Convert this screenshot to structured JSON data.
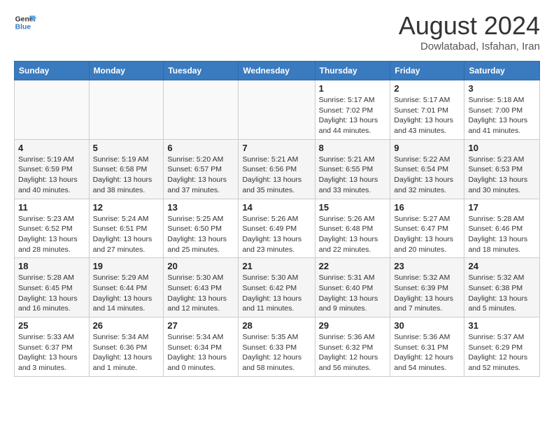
{
  "header": {
    "logo_line1": "General",
    "logo_line2": "Blue",
    "month_year": "August 2024",
    "location": "Dowlatabad, Isfahan, Iran"
  },
  "weekdays": [
    "Sunday",
    "Monday",
    "Tuesday",
    "Wednesday",
    "Thursday",
    "Friday",
    "Saturday"
  ],
  "weeks": [
    [
      {
        "day": "",
        "info": ""
      },
      {
        "day": "",
        "info": ""
      },
      {
        "day": "",
        "info": ""
      },
      {
        "day": "",
        "info": ""
      },
      {
        "day": "1",
        "info": "Sunrise: 5:17 AM\nSunset: 7:02 PM\nDaylight: 13 hours\nand 44 minutes."
      },
      {
        "day": "2",
        "info": "Sunrise: 5:17 AM\nSunset: 7:01 PM\nDaylight: 13 hours\nand 43 minutes."
      },
      {
        "day": "3",
        "info": "Sunrise: 5:18 AM\nSunset: 7:00 PM\nDaylight: 13 hours\nand 41 minutes."
      }
    ],
    [
      {
        "day": "4",
        "info": "Sunrise: 5:19 AM\nSunset: 6:59 PM\nDaylight: 13 hours\nand 40 minutes."
      },
      {
        "day": "5",
        "info": "Sunrise: 5:19 AM\nSunset: 6:58 PM\nDaylight: 13 hours\nand 38 minutes."
      },
      {
        "day": "6",
        "info": "Sunrise: 5:20 AM\nSunset: 6:57 PM\nDaylight: 13 hours\nand 37 minutes."
      },
      {
        "day": "7",
        "info": "Sunrise: 5:21 AM\nSunset: 6:56 PM\nDaylight: 13 hours\nand 35 minutes."
      },
      {
        "day": "8",
        "info": "Sunrise: 5:21 AM\nSunset: 6:55 PM\nDaylight: 13 hours\nand 33 minutes."
      },
      {
        "day": "9",
        "info": "Sunrise: 5:22 AM\nSunset: 6:54 PM\nDaylight: 13 hours\nand 32 minutes."
      },
      {
        "day": "10",
        "info": "Sunrise: 5:23 AM\nSunset: 6:53 PM\nDaylight: 13 hours\nand 30 minutes."
      }
    ],
    [
      {
        "day": "11",
        "info": "Sunrise: 5:23 AM\nSunset: 6:52 PM\nDaylight: 13 hours\nand 28 minutes."
      },
      {
        "day": "12",
        "info": "Sunrise: 5:24 AM\nSunset: 6:51 PM\nDaylight: 13 hours\nand 27 minutes."
      },
      {
        "day": "13",
        "info": "Sunrise: 5:25 AM\nSunset: 6:50 PM\nDaylight: 13 hours\nand 25 minutes."
      },
      {
        "day": "14",
        "info": "Sunrise: 5:26 AM\nSunset: 6:49 PM\nDaylight: 13 hours\nand 23 minutes."
      },
      {
        "day": "15",
        "info": "Sunrise: 5:26 AM\nSunset: 6:48 PM\nDaylight: 13 hours\nand 22 minutes."
      },
      {
        "day": "16",
        "info": "Sunrise: 5:27 AM\nSunset: 6:47 PM\nDaylight: 13 hours\nand 20 minutes."
      },
      {
        "day": "17",
        "info": "Sunrise: 5:28 AM\nSunset: 6:46 PM\nDaylight: 13 hours\nand 18 minutes."
      }
    ],
    [
      {
        "day": "18",
        "info": "Sunrise: 5:28 AM\nSunset: 6:45 PM\nDaylight: 13 hours\nand 16 minutes."
      },
      {
        "day": "19",
        "info": "Sunrise: 5:29 AM\nSunset: 6:44 PM\nDaylight: 13 hours\nand 14 minutes."
      },
      {
        "day": "20",
        "info": "Sunrise: 5:30 AM\nSunset: 6:43 PM\nDaylight: 13 hours\nand 12 minutes."
      },
      {
        "day": "21",
        "info": "Sunrise: 5:30 AM\nSunset: 6:42 PM\nDaylight: 13 hours\nand 11 minutes."
      },
      {
        "day": "22",
        "info": "Sunrise: 5:31 AM\nSunset: 6:40 PM\nDaylight: 13 hours\nand 9 minutes."
      },
      {
        "day": "23",
        "info": "Sunrise: 5:32 AM\nSunset: 6:39 PM\nDaylight: 13 hours\nand 7 minutes."
      },
      {
        "day": "24",
        "info": "Sunrise: 5:32 AM\nSunset: 6:38 PM\nDaylight: 13 hours\nand 5 minutes."
      }
    ],
    [
      {
        "day": "25",
        "info": "Sunrise: 5:33 AM\nSunset: 6:37 PM\nDaylight: 13 hours\nand 3 minutes."
      },
      {
        "day": "26",
        "info": "Sunrise: 5:34 AM\nSunset: 6:36 PM\nDaylight: 13 hours\nand 1 minute."
      },
      {
        "day": "27",
        "info": "Sunrise: 5:34 AM\nSunset: 6:34 PM\nDaylight: 13 hours\nand 0 minutes."
      },
      {
        "day": "28",
        "info": "Sunrise: 5:35 AM\nSunset: 6:33 PM\nDaylight: 12 hours\nand 58 minutes."
      },
      {
        "day": "29",
        "info": "Sunrise: 5:36 AM\nSunset: 6:32 PM\nDaylight: 12 hours\nand 56 minutes."
      },
      {
        "day": "30",
        "info": "Sunrise: 5:36 AM\nSunset: 6:31 PM\nDaylight: 12 hours\nand 54 minutes."
      },
      {
        "day": "31",
        "info": "Sunrise: 5:37 AM\nSunset: 6:29 PM\nDaylight: 12 hours\nand 52 minutes."
      }
    ]
  ]
}
